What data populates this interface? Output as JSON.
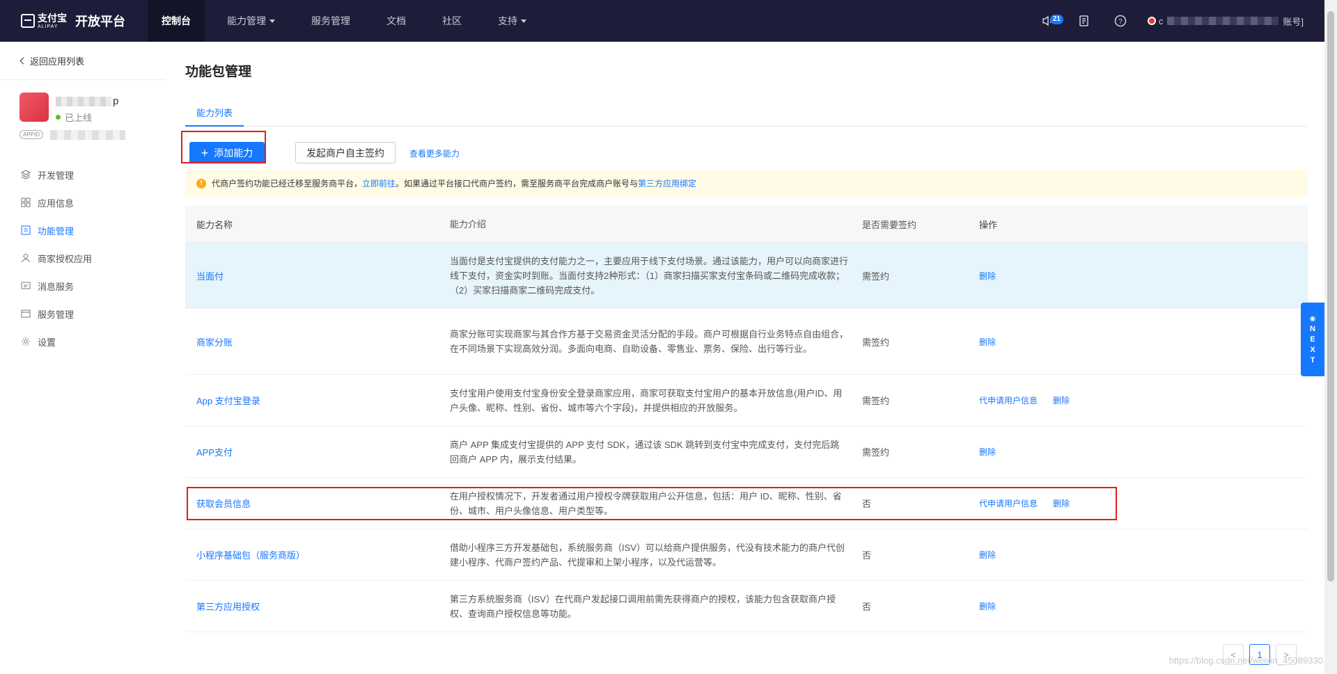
{
  "brand": {
    "cn": "支付宝",
    "en": "ALIPAY",
    "title": "开放平台"
  },
  "nav": {
    "items": [
      {
        "label": "控制台"
      },
      {
        "label": "能力管理"
      },
      {
        "label": "服务管理"
      },
      {
        "label": "文档"
      },
      {
        "label": "社区"
      },
      {
        "label": "支持"
      }
    ],
    "badge": "21",
    "account_prefix": "c",
    "account_suffix": "账号]"
  },
  "sidebar": {
    "back": "返回应用列表",
    "app_name_suffix": "p",
    "app_status": "已上线",
    "appid_tag": "APPID",
    "menu": [
      {
        "label": "开发管理",
        "icon": "layers-icon"
      },
      {
        "label": "应用信息",
        "icon": "grid-icon"
      },
      {
        "label": "功能管理",
        "icon": "list-icon"
      },
      {
        "label": "商家授权应用",
        "icon": "user-icon"
      },
      {
        "label": "消息服务",
        "icon": "message-icon"
      },
      {
        "label": "服务管理",
        "icon": "service-icon"
      },
      {
        "label": "设置",
        "icon": "gear-icon"
      }
    ]
  },
  "page": {
    "title": "功能包管理",
    "tab": "能力列表",
    "add_button": "添加能力",
    "sign_button": "发起商户自主签约",
    "more_link": "查看更多能力",
    "alert": {
      "text1": "代商户签约功能已经迁移至服务商平台，",
      "link1": "立即前往",
      "text2": "。如果通过平台接口代商户签约，需至服务商平台完成商户账号与",
      "link2": "第三方应用绑定"
    }
  },
  "table": {
    "headers": [
      "能力名称",
      "能力介绍",
      "是否需要签约",
      "操作"
    ],
    "rows": [
      {
        "name": "当面付",
        "desc": "当面付是支付宝提供的支付能力之一，主要应用于线下支付场景。通过该能力，用户可以向商家进行线下支付，资金实时到账。当面付支持2种形式：（1）商家扫描买家支付宝条码或二维码完成收款；（2）买家扫描商家二维码完成支付。",
        "sign": "需签约",
        "ops": [
          "删除"
        ]
      },
      {
        "name": "商家分账",
        "desc": "商家分账可实现商家与其合作方基于交易资金灵活分配的手段。商户可根据自行业务特点自由组合，在不同场景下实现高效分润。多面向电商、自助设备、零售业、票务、保险、出行等行业。",
        "sign": "需签约",
        "ops": [
          "删除"
        ]
      },
      {
        "name": "App 支付宝登录",
        "desc": "支付宝用户使用支付宝身份安全登录商家应用，商家可获取支付宝用户的基本开放信息(用户ID、用户头像、昵称、性别、省份、城市等六个字段)，并提供相应的开放服务。",
        "sign": "需签约",
        "ops": [
          "代申请用户信息",
          "删除"
        ]
      },
      {
        "name": "APP支付",
        "desc": "商户 APP 集成支付宝提供的 APP 支付 SDK，通过该 SDK 跳转到支付宝中完成支付，支付完后跳回商户 APP 内，展示支付结果。",
        "sign": "需签约",
        "ops": [
          "删除"
        ]
      },
      {
        "name": "获取会员信息",
        "desc": "在用户授权情况下，开发者通过用户授权令牌获取用户公开信息，包括：用户 ID、昵称、性别、省份、城市、用户头像信息、用户类型等。",
        "sign": "否",
        "ops": [
          "代申请用户信息",
          "删除"
        ]
      },
      {
        "name": "小程序基础包（服务商版）",
        "desc": "借助小程序三方开发基础包，系统服务商（ISV）可以给商户提供服务，代没有技术能力的商户代创建小程序、代商户签约产品、代提审和上架小程序，以及代运营等。",
        "sign": "否",
        "ops": [
          "删除"
        ]
      },
      {
        "name": "第三方应用授权",
        "desc": "第三方系统服务商（ISV）在代商户发起接口调用前需先获得商户的授权，该能力包含获取商户授权、查询商户授权信息等功能。",
        "sign": "否",
        "ops": [
          "删除"
        ]
      }
    ]
  },
  "pager": {
    "prev": "<",
    "current": "1",
    "next": ">"
  },
  "float": {
    "letters": [
      "N",
      "E",
      "X",
      "T"
    ]
  },
  "watermark": "https://blog.csdn.net/weixin_45089330"
}
